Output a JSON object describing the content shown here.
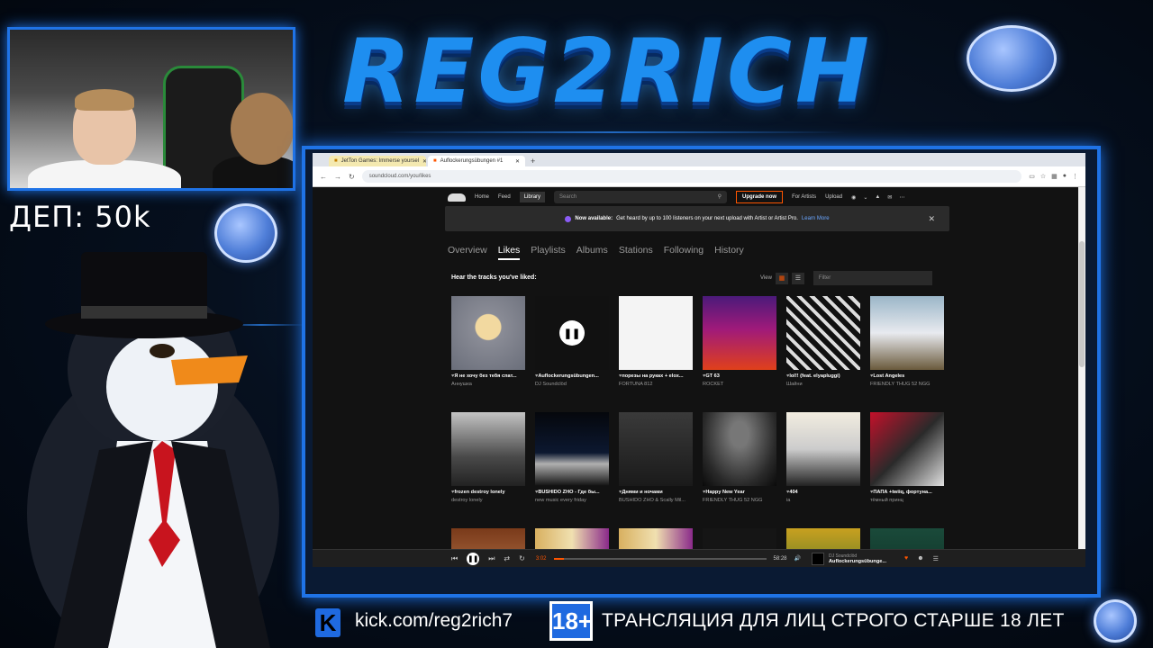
{
  "overlay": {
    "brand_title": "REG2RICH",
    "deposit_text": "ДЕП: 50k",
    "kick_logo_text": "K",
    "kick_url": "kick.com/reg2rich7",
    "age_badge": "18+",
    "age_notice": "ТРАНСЛЯЦИЯ ДЛЯ ЛИЦ СТРОГО СТАРШЕ 18 ЛЕТ",
    "accent_color": "#1f73e6"
  },
  "browser": {
    "tabs": [
      {
        "label": "JetTon Games: Immerse yoursel",
        "active": false
      },
      {
        "label": "Auflockerungsübungen #1",
        "active": true
      }
    ],
    "url": "soundcloud.com/you/likes"
  },
  "soundcloud": {
    "nav": {
      "home": "Home",
      "feed": "Feed",
      "library": "Library",
      "search_placeholder": "Search",
      "upgrade": "Upgrade now",
      "for_artists": "For Artists",
      "upload": "Upload"
    },
    "banner": {
      "bold": "Now available:",
      "text": "Get heard by up to 100 listeners on your next upload with Artist or Artist Pro.",
      "link": "Learn More"
    },
    "subtabs": [
      "Overview",
      "Likes",
      "Playlists",
      "Albums",
      "Stations",
      "Following",
      "History"
    ],
    "active_subtab": "Likes",
    "likes_header": "Hear the tracks you've liked:",
    "view_label": "View",
    "filter_placeholder": "Filter",
    "tracks": [
      {
        "title": "Я не хочу без тебя спат...",
        "artist": "Аннушка",
        "art": "moon"
      },
      {
        "title": "Auflockerungsübungen...",
        "artist": "DJ Soundclöd",
        "art": "hash",
        "playing": true
      },
      {
        "title": "порезы на руках + elox...",
        "artist": "FORTUNA 812",
        "art": "white"
      },
      {
        "title": "GT 63",
        "artist": "ROCKET",
        "art": "purple"
      },
      {
        "title": "lol!! (feat. elyapluggi)",
        "artist": "Шайни",
        "art": "bw-hash"
      },
      {
        "title": "Lost Angeles",
        "artist": "FRIENDLY THUG 52 NGG",
        "art": "ship"
      },
      {
        "title": "frozen destroy lonely",
        "artist": "destroy lonely",
        "art": "room"
      },
      {
        "title": "BUSHIDO ZHO - Где бы...",
        "artist": "new music every friday",
        "art": "city"
      },
      {
        "title": "Днями и ночами",
        "artist": "BUSHIDO ZHO & Scally Mil...",
        "art": "dark-room"
      },
      {
        "title": "Happy New Year",
        "artist": "FRIENDLY THUG 52 NGG",
        "art": "spotlight"
      },
      {
        "title": "404",
        "artist": "ia",
        "art": "poster"
      },
      {
        "title": "ПАПА +twiiq, фортуна...",
        "artist": "тёмный принц",
        "art": "red-poster"
      },
      {
        "title": "",
        "artist": "",
        "art": "woman"
      },
      {
        "title": "",
        "artist": "",
        "art": "food"
      },
      {
        "title": "",
        "artist": "",
        "art": "food"
      },
      {
        "title": "",
        "artist": "",
        "art": "black"
      },
      {
        "title": "",
        "artist": "",
        "art": "gold"
      },
      {
        "title": "",
        "artist": "",
        "art": "yung"
      }
    ],
    "player": {
      "elapsed": "3:02",
      "duration": "58:28",
      "progress_fraction": 0.05,
      "artist": "DJ Soundclöd",
      "track": "Auflockerungsübunge..."
    }
  }
}
